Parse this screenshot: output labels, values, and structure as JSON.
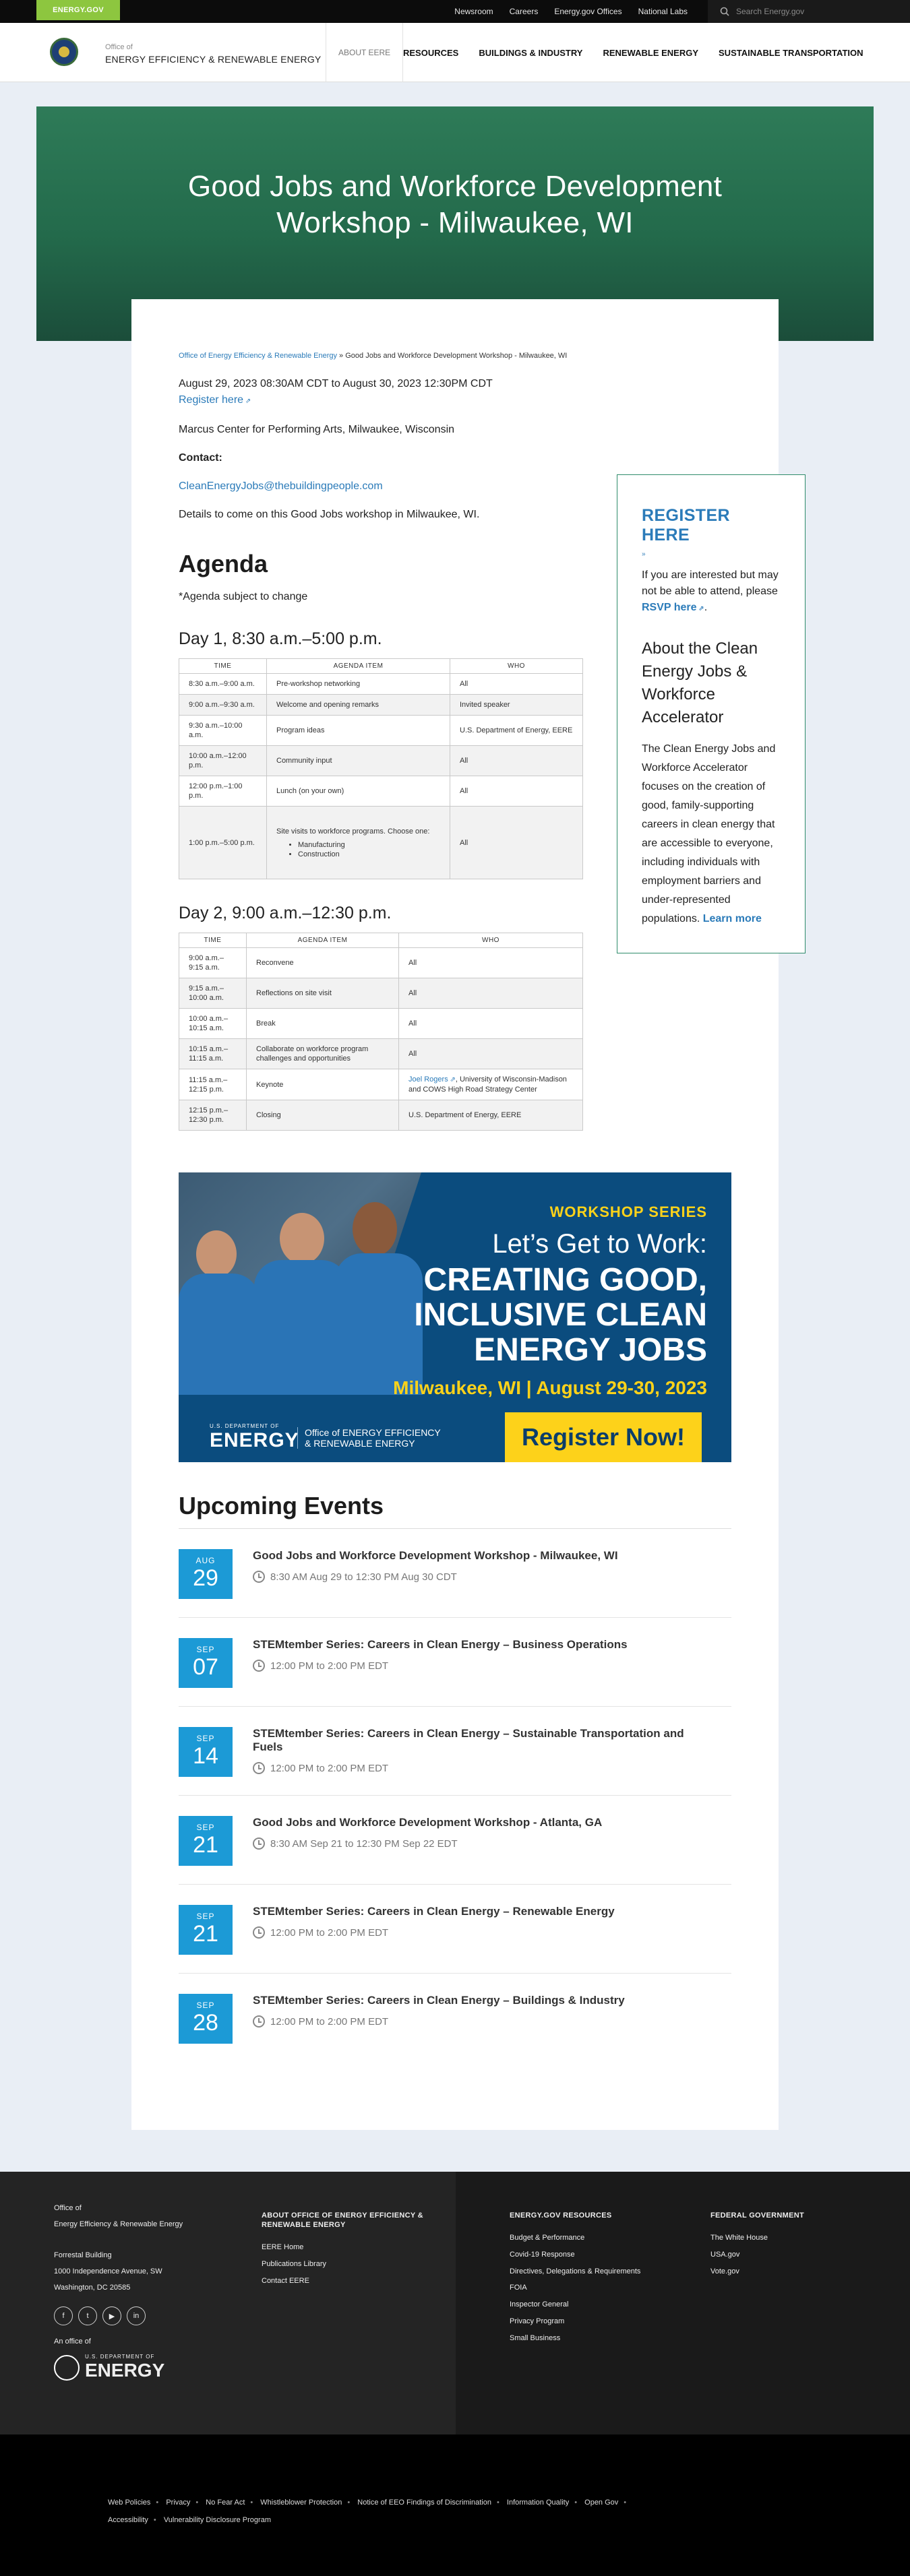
{
  "topbar": {
    "brand": "ENERGY.GOV",
    "links": [
      "Newsroom",
      "Careers",
      "Energy.gov Offices",
      "National Labs"
    ],
    "search_placeholder": "Search Energy.gov"
  },
  "header": {
    "office_of": "Office of",
    "office_name": "ENERGY EFFICIENCY & RENEWABLE ENERGY",
    "about": "ABOUT EERE",
    "nav": [
      "RESOURCES",
      "BUILDINGS & INDUSTRY",
      "RENEWABLE ENERGY",
      "SUSTAINABLE TRANSPORTATION"
    ]
  },
  "hero": {
    "title_line1": "Good Jobs and Workforce Development",
    "title_line2": "Workshop - Milwaukee, WI"
  },
  "breadcrumb": {
    "link": "Office of Energy Efficiency & Renewable Energy",
    "separator": " » ",
    "current": "Good Jobs and Workforce Development Workshop - Milwaukee, WI"
  },
  "event": {
    "dates": "August 29, 2023 08:30AM CDT to August 30, 2023 12:30PM CDT",
    "register": "Register here",
    "venue": "Marcus Center for Performing Arts, Milwaukee, Wisconsin",
    "contact_label": "Contact:",
    "contact_email": "CleanEnergyJobs@thebuildingpeople.com",
    "details": "Details to come on this Good Jobs workshop in Milwaukee, WI."
  },
  "agenda": {
    "title": "Agenda",
    "note": "*Agenda subject to change",
    "day1": {
      "heading": "Day 1, 8:30 a.m.–5:00 p.m.",
      "columns": [
        "TIME",
        "AGENDA ITEM",
        "WHO"
      ],
      "rows": [
        [
          "8:30 a.m.–9:00 a.m.",
          "Pre-workshop networking",
          "All"
        ],
        [
          "9:00 a.m.–9:30 a.m.",
          "Welcome and opening remarks",
          "Invited speaker"
        ],
        [
          "9:30 a.m.–10:00 a.m.",
          "Program ideas",
          "U.S. Department of Energy, EERE"
        ],
        [
          "10:00 a.m.–12:00 p.m.",
          "Community input",
          "All"
        ],
        [
          "12:00 p.m.–1:00 p.m.",
          "Lunch (on your own)",
          "All"
        ]
      ],
      "last_row": {
        "time": "1:00 p.m.–5:00 p.m.",
        "item": "Site visits to workforce programs. Choose one:",
        "bullets": [
          "Manufacturing",
          "Construction"
        ],
        "who": "All"
      }
    },
    "day2": {
      "heading": "Day 2, 9:00 a.m.–12:30 p.m.",
      "columns": [
        "TIME",
        "AGENDA ITEM",
        "WHO"
      ],
      "rows": [
        [
          "9:00 a.m.–9:15 a.m.",
          "Reconvene",
          "All"
        ],
        [
          "9:15 a.m.–10:00 a.m.",
          "Reflections on site visit",
          "All"
        ],
        [
          "10:00 a.m.–10:15 a.m.",
          "Break",
          "All"
        ],
        [
          "10:15 a.m.–11:15 a.m.",
          "Collaborate on workforce program challenges and opportunities",
          "All"
        ]
      ],
      "keynote_row": {
        "time": "11:15 a.m.–12:15 p.m.",
        "item": "Keynote",
        "who_link": "Joel Rogers",
        "who_rest": ", University of Wisconsin-Madison and COWS High Road Strategy Center"
      },
      "closing_row": [
        "12:15 p.m.–12:30 p.m.",
        "Closing",
        "U.S. Department of Energy, EERE"
      ]
    }
  },
  "sidebar": {
    "title": "REGISTER HERE",
    "small": "»",
    "text_before": "If you are interested but may not be able to attend, please ",
    "rsvp": "RSVP here",
    "text_after": ".",
    "about_title": "About the Clean Energy Jobs & Workforce Accelerator",
    "about_text": "The Clean Energy Jobs and Workforce Accelerator focuses on the creation of good, family-supporting careers in clean energy that are accessible to everyone, including individuals with employment barriers and under-represented populations. ",
    "learn_more": "Learn more"
  },
  "banner": {
    "series": "WORKSHOP SERIES",
    "lets": "Let’s Get to Work:",
    "line1": "CREATING GOOD,",
    "line2": "INCLUSIVE CLEAN",
    "line3": "ENERGY JOBS",
    "location": "Milwaukee, WI  |  August 29-30, 2023",
    "doe_small": "U.S. DEPARTMENT OF",
    "doe_big": "ENERGY",
    "office_line1": "Office of ENERGY EFFICIENCY",
    "office_line2": "& RENEWABLE ENERGY",
    "cta": "Register Now!"
  },
  "upcoming": {
    "title": "Upcoming Events",
    "events": [
      {
        "mon": "AUG",
        "day": "29",
        "title": "Good Jobs and Workforce Development Workshop - Milwaukee, WI",
        "time": "8:30 AM Aug 29 to 12:30 PM Aug 30 CDT"
      },
      {
        "mon": "SEP",
        "day": "07",
        "title": "STEMtember Series: Careers in Clean Energy – Business Operations",
        "time": "12:00 PM to 2:00 PM EDT"
      },
      {
        "mon": "SEP",
        "day": "14",
        "title": "STEMtember Series: Careers in Clean Energy – Sustainable Transportation and Fuels",
        "time": "12:00 PM to 2:00 PM EDT"
      },
      {
        "mon": "SEP",
        "day": "21",
        "title": "Good Jobs and Workforce Development Workshop - Atlanta, GA",
        "time": "8:30 AM Sep 21 to 12:30 PM Sep 22 EDT"
      },
      {
        "mon": "SEP",
        "day": "21",
        "title": "STEMtember Series: Careers in Clean Energy – Renewable Energy",
        "time": "12:00 PM to 2:00 PM EDT"
      },
      {
        "mon": "SEP",
        "day": "28",
        "title": "STEMtember Series: Careers in Clean Energy – Buildings & Industry",
        "time": "12:00 PM to 2:00 PM EDT"
      }
    ]
  },
  "footer": {
    "office_of": "Office of",
    "office_name": "Energy Efficiency & Renewable Energy",
    "addr1": "Forrestal Building",
    "addr2": "1000 Independence Avenue, SW",
    "addr3": "Washington, DC 20585",
    "social": [
      "f",
      "t",
      "▶",
      "in"
    ],
    "an_office_of": "An office of",
    "doe_small": "U.S. DEPARTMENT OF",
    "doe_big": "ENERGY",
    "about_heading": "ABOUT OFFICE OF ENERGY EFFICIENCY & RENEWABLE ENERGY",
    "about_links": [
      "EERE Home",
      "Publications Library",
      "Contact EERE"
    ],
    "resources_heading": "ENERGY.GOV RESOURCES",
    "resources_links": [
      "Budget & Performance",
      "Covid-19 Response",
      "Directives, Delegations & Requirements",
      "FOIA",
      "Inspector General",
      "Privacy Program",
      "Small Business"
    ],
    "federal_heading": "FEDERAL GOVERNMENT",
    "federal_links": [
      "The White House",
      "USA.gov",
      "Vote.gov"
    ]
  },
  "bottom_links": [
    "Web Policies",
    "Privacy",
    "No Fear Act",
    "Whistleblower Protection",
    "Notice of EEO Findings of Discrimination",
    "Information Quality",
    "Open Gov",
    "Accessibility",
    "Vulnerability Disclosure Program"
  ]
}
